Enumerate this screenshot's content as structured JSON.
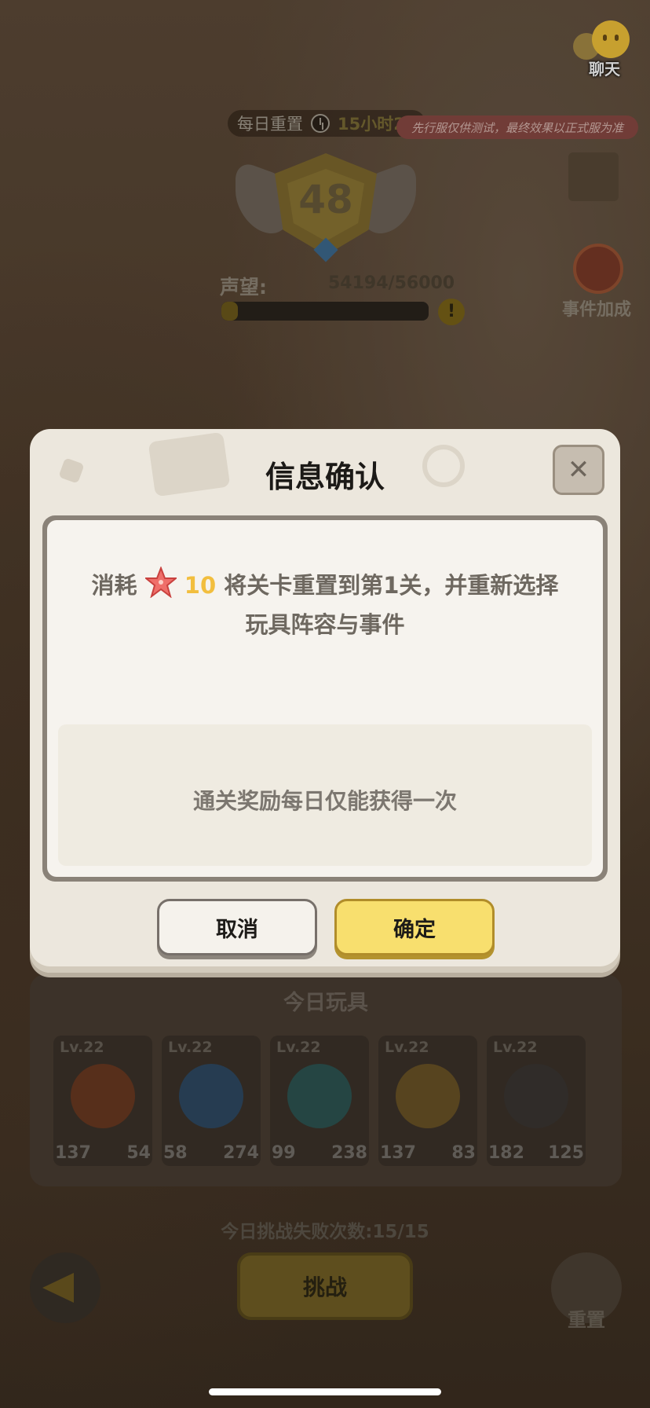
{
  "header": {
    "chat_label": "聊天",
    "daily_reset_label": "每日重置",
    "timer": "15小时23",
    "test_notice": "先行服仅供测试，最终效果以正式服为准"
  },
  "rank": {
    "level": "48"
  },
  "reputation": {
    "label": "声望:",
    "value": "54194/56000",
    "progress": 0.08
  },
  "event_bonus": {
    "label": "事件加成"
  },
  "dialog": {
    "title": "信息确认",
    "close_symbol": "✕",
    "message_prefix": "消耗",
    "cost_amount": "10",
    "message_line1_suffix": "将关卡重置到第1关，并重新选择",
    "message_line2": "玩具阵容与事件",
    "reward_note": "通关奖励每日仅能获得一次",
    "cancel_label": "取消",
    "confirm_label": "确定"
  },
  "toys": {
    "title": "今日玩具",
    "cards": [
      {
        "level": "Lv.22",
        "atk": "137",
        "hp": "54",
        "color": "#6b3a22"
      },
      {
        "level": "Lv.22",
        "atk": "58",
        "hp": "274",
        "color": "#2f4a63"
      },
      {
        "level": "Lv.22",
        "atk": "99",
        "hp": "238",
        "color": "#2e5552"
      },
      {
        "level": "Lv.22",
        "atk": "137",
        "hp": "83",
        "color": "#6b5426"
      },
      {
        "level": "Lv.22",
        "atk": "182",
        "hp": "125",
        "color": "#3b3632"
      }
    ]
  },
  "footer": {
    "fail_count": "今日挑战失败次数:15/15",
    "challenge_label": "挑战",
    "reset_label": "重置"
  }
}
